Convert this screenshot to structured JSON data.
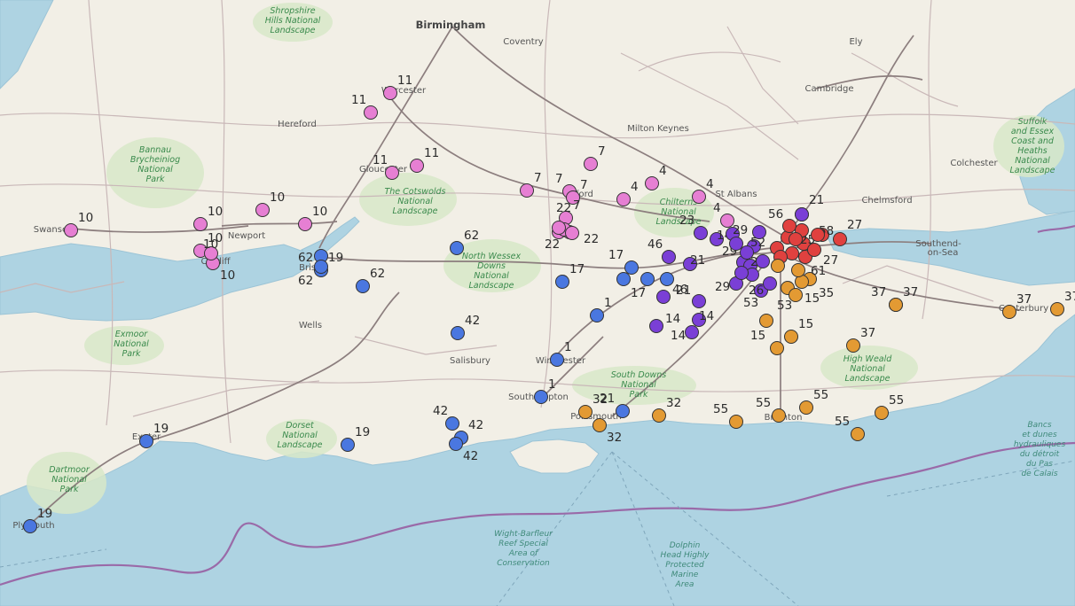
{
  "map": {
    "colors": {
      "land": "#f2efe6",
      "sea": "#aed3e2",
      "park": "#d8e8c8",
      "road_major": "#8c7e7e",
      "road_minor": "#c9b8b8",
      "boundary": "#9a6aa8",
      "marker_edge": "#333333"
    },
    "clusters": [
      {
        "name": "pink",
        "color": "#e67fd3"
      },
      {
        "name": "blue",
        "color": "#4a77e0"
      },
      {
        "name": "violet",
        "color": "#7a3fd6"
      },
      {
        "name": "red",
        "color": "#e0413f"
      },
      {
        "name": "orange",
        "color": "#e39a33"
      }
    ],
    "places": [
      {
        "name": "Birmingham",
        "cls": "city"
      },
      {
        "name": "Coventry",
        "cls": "place"
      },
      {
        "name": "Ely",
        "cls": "place"
      },
      {
        "name": "Hereford",
        "cls": "place"
      },
      {
        "name": "Cambridge",
        "cls": "place"
      },
      {
        "name": "Milton Keynes",
        "cls": "place"
      },
      {
        "name": "Colchester",
        "cls": "place"
      },
      {
        "name": "Gloucester",
        "cls": "place"
      },
      {
        "name": "St Albans",
        "cls": "place"
      },
      {
        "name": "Chelmsford",
        "cls": "place"
      },
      {
        "name": "Newport",
        "cls": "place"
      },
      {
        "name": "Southend-",
        "cls": "place"
      },
      {
        "name": "on-Sea",
        "cls": "place"
      },
      {
        "name": "Wells",
        "cls": "place"
      },
      {
        "name": "Salisbury",
        "cls": "place"
      },
      {
        "name": "Winchester",
        "cls": "place"
      },
      {
        "name": "Southampton",
        "cls": "place"
      },
      {
        "name": "Portsmouth",
        "cls": "place"
      },
      {
        "name": "Brighton",
        "cls": "place"
      },
      {
        "name": "Canterbury",
        "cls": "place"
      },
      {
        "name": "Plymouth",
        "cls": "place"
      },
      {
        "name": "Exeter",
        "cls": "place"
      },
      {
        "name": "Bristol",
        "cls": "place"
      },
      {
        "name": "Cardiff",
        "cls": "place"
      },
      {
        "name": "Swansea",
        "cls": "place"
      },
      {
        "name": "Worcester",
        "cls": "place"
      },
      {
        "name": "Oxford",
        "cls": "place"
      }
    ],
    "areas": [
      {
        "lines": [
          "Shropshire",
          "Hills National",
          "Landscape"
        ],
        "cls": "park"
      },
      {
        "lines": [
          "Bannau",
          "Brycheiniog",
          "National",
          "Park"
        ],
        "cls": "park"
      },
      {
        "lines": [
          "The Cotswolds",
          "National",
          "Landscape"
        ],
        "cls": "park"
      },
      {
        "lines": [
          "Chilterns",
          "National",
          "Landscape"
        ],
        "cls": "park"
      },
      {
        "lines": [
          "North Wessex",
          "Downs",
          "National",
          "Landscape"
        ],
        "cls": "park"
      },
      {
        "lines": [
          "Exmoor",
          "National",
          "Park"
        ],
        "cls": "park"
      },
      {
        "lines": [
          "Dorset",
          "National",
          "Landscape"
        ],
        "cls": "park"
      },
      {
        "lines": [
          "Dartmoor",
          "National",
          "Park"
        ],
        "cls": "park"
      },
      {
        "lines": [
          "South Downs",
          "National",
          "Park"
        ],
        "cls": "park"
      },
      {
        "lines": [
          "High Weald",
          "National",
          "Landscape"
        ],
        "cls": "park"
      },
      {
        "lines": [
          "Suffolk",
          "and Essex",
          "Coast and",
          "Heaths",
          "National",
          "Landscape"
        ],
        "cls": "park"
      },
      {
        "lines": [
          "Wight-Barfleur",
          "Reef Special",
          "Area of",
          "Conservation"
        ],
        "cls": "sea"
      },
      {
        "lines": [
          "Dolphin",
          "Head Highly",
          "Protected",
          "Marine",
          "Area"
        ],
        "cls": "sea"
      },
      {
        "lines": [
          "Bancs",
          "et dunes",
          "hydrauliques",
          "du détroit",
          "du Pas",
          "de Calais"
        ],
        "cls": "sea"
      }
    ],
    "markers": [
      {
        "c": 0,
        "label": "11"
      },
      {
        "c": 0,
        "label": "11"
      },
      {
        "c": 0,
        "label": "11"
      },
      {
        "c": 0,
        "label": "11"
      },
      {
        "c": 0,
        "label": "10"
      },
      {
        "c": 0,
        "label": "10"
      },
      {
        "c": 0,
        "label": "10"
      },
      {
        "c": 0,
        "label": "10"
      },
      {
        "c": 0,
        "label": "10"
      },
      {
        "c": 0,
        "label": "10"
      },
      {
        "c": 0,
        "label": "10"
      },
      {
        "c": 0,
        "label": "7"
      },
      {
        "c": 0,
        "label": "7"
      },
      {
        "c": 0,
        "label": "7"
      },
      {
        "c": 0,
        "label": "7"
      },
      {
        "c": 0,
        "label": "7"
      },
      {
        "c": 0,
        "label": "4"
      },
      {
        "c": 0,
        "label": "4"
      },
      {
        "c": 0,
        "label": "4"
      },
      {
        "c": 0,
        "label": "4"
      },
      {
        "c": 0,
        "label": "22"
      },
      {
        "c": 0,
        "label": "22"
      },
      {
        "c": 0,
        "label": "22"
      },
      {
        "c": 0,
        "label": ""
      },
      {
        "c": 0,
        "label": ""
      },
      {
        "c": 1,
        "label": "62"
      },
      {
        "c": 1,
        "label": "19"
      },
      {
        "c": 1,
        "label": "62"
      },
      {
        "c": 1,
        "label": "62"
      },
      {
        "c": 1,
        "label": "62"
      },
      {
        "c": 1,
        "label": "42"
      },
      {
        "c": 1,
        "label": "42"
      },
      {
        "c": 1,
        "label": "42"
      },
      {
        "c": 1,
        "label": "42"
      },
      {
        "c": 1,
        "label": "19"
      },
      {
        "c": 1,
        "label": "19"
      },
      {
        "c": 1,
        "label": "19"
      },
      {
        "c": 1,
        "label": "17"
      },
      {
        "c": 1,
        "label": "17"
      },
      {
        "c": 1,
        "label": "17"
      },
      {
        "c": 1,
        "label": ""
      },
      {
        "c": 1,
        "label": ""
      },
      {
        "c": 1,
        "label": "1"
      },
      {
        "c": 1,
        "label": "1"
      },
      {
        "c": 1,
        "label": "1"
      },
      {
        "c": 1,
        "label": "21"
      },
      {
        "c": 2,
        "label": "46"
      },
      {
        "c": 2,
        "label": "46"
      },
      {
        "c": 2,
        "label": "21"
      },
      {
        "c": 2,
        "label": "21"
      },
      {
        "c": 2,
        "label": "23"
      },
      {
        "c": 2,
        "label": "14"
      },
      {
        "c": 2,
        "label": "14"
      },
      {
        "c": 2,
        "label": "14"
      },
      {
        "c": 2,
        "label": "14"
      },
      {
        "c": 2,
        "label": "29"
      },
      {
        "c": 2,
        "label": "29"
      },
      {
        "c": 2,
        "label": "29"
      },
      {
        "c": 2,
        "label": "26"
      },
      {
        "c": 2,
        "label": "26"
      },
      {
        "c": 2,
        "label": "56"
      },
      {
        "c": 2,
        "label": "52"
      },
      {
        "c": 2,
        "label": "21"
      },
      {
        "c": 2,
        "label": ""
      },
      {
        "c": 2,
        "label": ""
      },
      {
        "c": 2,
        "label": ""
      },
      {
        "c": 2,
        "label": ""
      },
      {
        "c": 2,
        "label": ""
      },
      {
        "c": 2,
        "label": ""
      },
      {
        "c": 2,
        "label": ""
      },
      {
        "c": 3,
        "label": "58"
      },
      {
        "c": 3,
        "label": "27"
      },
      {
        "c": 3,
        "label": "25"
      },
      {
        "c": 3,
        "label": "27"
      },
      {
        "c": 3,
        "label": ""
      },
      {
        "c": 3,
        "label": ""
      },
      {
        "c": 3,
        "label": ""
      },
      {
        "c": 3,
        "label": ""
      },
      {
        "c": 3,
        "label": ""
      },
      {
        "c": 3,
        "label": ""
      },
      {
        "c": 3,
        "label": ""
      },
      {
        "c": 3,
        "label": ""
      },
      {
        "c": 3,
        "label": ""
      },
      {
        "c": 4,
        "label": "53"
      },
      {
        "c": 4,
        "label": "53"
      },
      {
        "c": 4,
        "label": "15"
      },
      {
        "c": 4,
        "label": "15"
      },
      {
        "c": 4,
        "label": "15"
      },
      {
        "c": 4,
        "label": "35"
      },
      {
        "c": 4,
        "label": "61"
      },
      {
        "c": 4,
        "label": "37"
      },
      {
        "c": 4,
        "label": "37"
      },
      {
        "c": 4,
        "label": "37"
      },
      {
        "c": 4,
        "label": "37"
      },
      {
        "c": 4,
        "label": "37"
      },
      {
        "c": 4,
        "label": "55"
      },
      {
        "c": 4,
        "label": "55"
      },
      {
        "c": 4,
        "label": "55"
      },
      {
        "c": 4,
        "label": "55"
      },
      {
        "c": 4,
        "label": "55"
      },
      {
        "c": 4,
        "label": "32"
      },
      {
        "c": 4,
        "label": "32"
      },
      {
        "c": 4,
        "label": "32"
      },
      {
        "c": 4,
        "label": ""
      },
      {
        "c": 4,
        "label": ""
      }
    ]
  }
}
